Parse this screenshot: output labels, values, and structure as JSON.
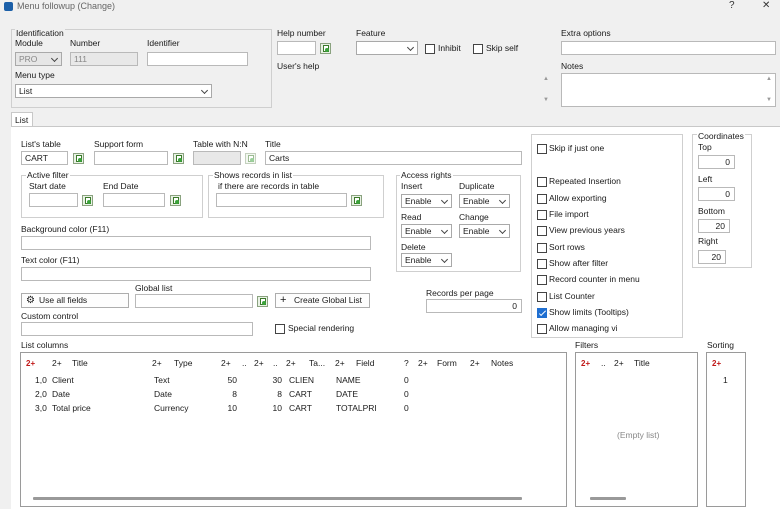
{
  "window": {
    "title": "Menu followup (Change)",
    "help_btn": "?",
    "close_btn": "✕"
  },
  "identification": {
    "header": "Identification",
    "module_label": "Module",
    "module_value": "PRO",
    "number_label": "Number",
    "number_value": "111",
    "identifier_label": "Identifier",
    "identifier_value": "",
    "menu_type_label": "Menu type",
    "menu_type_value": "List"
  },
  "help": {
    "help_number_label": "Help number",
    "feature_label": "Feature",
    "inhibit_label": "Inhibit",
    "skip_self_label": "Skip self",
    "users_help_label": "User's help"
  },
  "extra": {
    "extra_options_label": "Extra options",
    "notes_label": "Notes"
  },
  "tab": {
    "list_label": "List"
  },
  "list": {
    "lists_table_label": "List's table",
    "lists_table_value": "CART",
    "support_form_label": "Support form",
    "table_nn_label": "Table with N:N",
    "title_label": "Title",
    "title_value": "Carts",
    "active_filter_label": "Active filter",
    "start_date_label": "Start date",
    "end_date_label": "End Date",
    "shows_records_label": "Shows records in list",
    "if_records_label": "if there are records in table",
    "access_rights_label": "Access rights",
    "insert_label": "Insert",
    "insert_value": "Enable",
    "duplicate_label": "Duplicate",
    "duplicate_value": "Enable",
    "read_label": "Read",
    "read_value": "Enable",
    "change_label": "Change",
    "change_value": "Enable",
    "delete_label": "Delete",
    "delete_value": "Enable",
    "bg_color_label": "Background color (F11)",
    "text_color_label": "Text color (F11)",
    "use_all_fields_label": "Use all fields",
    "global_list_label": "Global list",
    "create_global_list_label": "Create Global List",
    "records_per_page_label": "Records per page",
    "records_per_page_value": "0",
    "custom_control_label": "Custom control",
    "special_rendering_label": "Special rendering"
  },
  "options": [
    {
      "label": "Skip if just one",
      "checked": false
    },
    {
      "label": "Repeated Insertion",
      "checked": false
    },
    {
      "label": "Allow exporting",
      "checked": false
    },
    {
      "label": "File import",
      "checked": false
    },
    {
      "label": "View previous years",
      "checked": false
    },
    {
      "label": "Sort rows",
      "checked": false
    },
    {
      "label": "Show after filter",
      "checked": false
    },
    {
      "label": "Record counter in menu",
      "checked": false
    },
    {
      "label": "List Counter",
      "checked": false
    },
    {
      "label": "Show limits (Tooltips)",
      "checked": true
    },
    {
      "label": "Allow managing vi",
      "checked": false
    }
  ],
  "coordinates": {
    "header": "Coordinates",
    "top_label": "Top",
    "top_value": "0",
    "left_label": "Left",
    "left_value": "0",
    "bottom_label": "Bottom",
    "bottom_value": "20",
    "right_label": "Right",
    "right_value": "20"
  },
  "list_columns": {
    "header": "List columns",
    "headers": [
      "Title",
      "Type",
      "..",
      "Ta...",
      "Field",
      "Form",
      "Notes"
    ],
    "rows": [
      {
        "num": "1,0",
        "title": "Client",
        "type": "Text",
        "a": "50",
        "b": "30",
        "table": "CLIEN",
        "field": "NAME",
        "c": "0"
      },
      {
        "num": "2,0",
        "title": "Date",
        "type": "Date",
        "a": "8",
        "b": "8",
        "table": "CART",
        "field": "DATE",
        "c": "0"
      },
      {
        "num": "3,0",
        "title": "Total price",
        "type": "Currency",
        "a": "10",
        "b": "10",
        "table": "CART",
        "field": "TOTALPRI",
        "c": "0"
      }
    ]
  },
  "filters": {
    "header": "Filters",
    "col_dots": "..",
    "col_title": "Title",
    "empty_text": "(Empty list)"
  },
  "sorting": {
    "header": "Sorting",
    "value": "1"
  },
  "colors": {
    "accent": "#1f6fd1",
    "sort_icon": "#c01818"
  }
}
